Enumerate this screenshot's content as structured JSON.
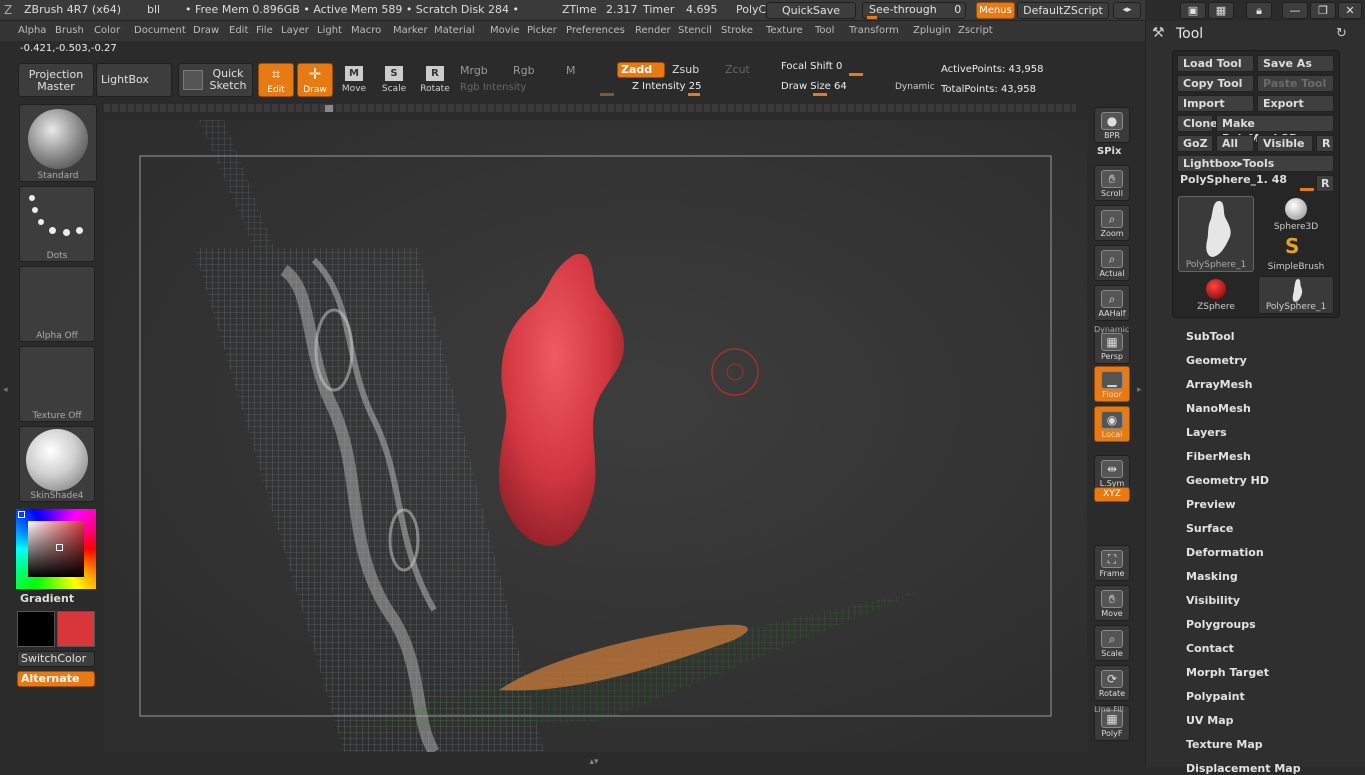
{
  "titlebar": {
    "app": "ZBrush 4R7 (x64)",
    "doc": "bll",
    "stats": "• Free Mem 0.896GB • Active Mem 589 • Scratch Disk 284 •",
    "ztime_label": "ZTime",
    "ztime": "2.317",
    "timer_label": "Timer",
    "timer": "4.695",
    "poly": "PolyC",
    "quicksave": "QuickSave",
    "seethrough_label": "See-through",
    "seethrough_value": "0",
    "menus": "Menus",
    "defaultzscript": "DefaultZScript"
  },
  "menubar": [
    "Alpha",
    "Brush",
    "Color",
    "Document",
    "Draw",
    "Edit",
    "File",
    "Layer",
    "Light",
    "Macro",
    "Marker",
    "Material",
    "Movie",
    "Picker",
    "Preferences",
    "Render",
    "Stencil",
    "Stroke",
    "Texture",
    "Tool",
    "Transform",
    "Zplugin",
    "Zscript"
  ],
  "coords": "-0.421,-0.503,-0.27",
  "toolbar": {
    "projection_master": "Projection Master",
    "lightbox": "LightBox",
    "quick_sketch": "Quick Sketch",
    "edit": "Edit",
    "draw": "Draw",
    "move": "Move",
    "scale": "Scale",
    "rotate": "Rotate",
    "mrgb": "Mrgb",
    "rgb": "Rgb",
    "m": "M",
    "rgb_intensity": "Rgb Intensity",
    "zadd": "Zadd",
    "zsub": "Zsub",
    "zcut": "Zcut",
    "z_intensity_label": "Z Intensity",
    "z_intensity": "25",
    "focal_shift_label": "Focal Shift",
    "focal_shift": "0",
    "draw_size_label": "Draw Size",
    "draw_size": "64",
    "dynamic": "Dynamic",
    "active_points": "ActivePoints: 43,958",
    "total_points": "TotalPoints: 43,958"
  },
  "left": {
    "brush": "Standard",
    "stroke": "Dots",
    "alpha": "Alpha Off",
    "texture": "Texture Off",
    "material": "SkinShade4",
    "gradient": "Gradient",
    "switchcolor": "SwitchColor",
    "alternate": "Alternate",
    "colors": {
      "main": "#000000",
      "secondary": "#d8363b"
    }
  },
  "right_shelf": [
    {
      "name": "bpr",
      "label": "BPR",
      "icon": "sphere-icon"
    },
    {
      "name": "scroll",
      "label": "Scroll",
      "icon": "hand-icon"
    },
    {
      "name": "zoom",
      "label": "Zoom",
      "icon": "magnifier-icon"
    },
    {
      "name": "actual",
      "label": "Actual",
      "icon": "magnifier-icon"
    },
    {
      "name": "aahalf",
      "label": "AAHalf",
      "icon": "magnifier-icon"
    },
    {
      "name": "persp",
      "label": "Persp",
      "icon": "grid-icon"
    },
    {
      "name": "floor",
      "label": "Floor",
      "icon": "floor-icon"
    },
    {
      "name": "local",
      "label": "Local",
      "icon": "local-icon"
    },
    {
      "name": "lsym",
      "label": "L.Sym",
      "icon": "sym-icon"
    },
    {
      "name": "frame",
      "label": "Frame",
      "icon": "frame-icon"
    },
    {
      "name": "move",
      "label": "Move",
      "icon": "hand-icon"
    },
    {
      "name": "scale",
      "label": "Scale",
      "icon": "magnifier-icon"
    },
    {
      "name": "rotate",
      "label": "Rotate",
      "icon": "rotate-icon"
    },
    {
      "name": "polyf",
      "label": "PolyF",
      "icon": "grid-icon"
    }
  ],
  "shelf_extra": {
    "spix": "SPix",
    "xyz": "XYZ",
    "dynamic": "Dynamic",
    "line_fill": "Line Fill"
  },
  "tool_panel": {
    "title": "Tool",
    "buttons": [
      [
        "Load Tool",
        "Save As"
      ],
      [
        "Copy Tool",
        "Paste Tool"
      ],
      [
        "Import",
        "Export"
      ],
      [
        "Clone",
        "Make PolyMesh3D"
      ],
      [
        "GoZ",
        "All",
        "Visible",
        "R"
      ]
    ],
    "lightbox_tools": "Lightbox▸Tools",
    "current_tool": "PolySphere_1. 48",
    "r": "R",
    "tiles": [
      "PolySphere_1",
      "Sphere3D",
      "SimpleBrush",
      "ZSphere",
      "PolySphere_1"
    ],
    "sections": [
      "SubTool",
      "Geometry",
      "ArrayMesh",
      "NanoMesh",
      "Layers",
      "FiberMesh",
      "Geometry HD",
      "Preview",
      "Surface",
      "Deformation",
      "Masking",
      "Visibility",
      "Polygroups",
      "Contact",
      "Morph Target",
      "Polypaint",
      "UV Map",
      "Texture Map",
      "Displacement Map"
    ]
  }
}
